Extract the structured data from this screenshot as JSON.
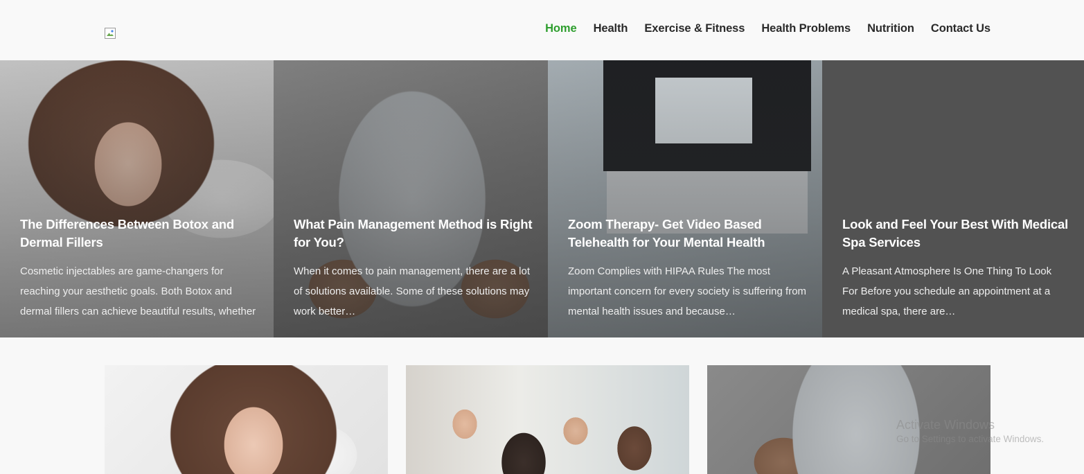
{
  "header": {
    "nav": [
      {
        "label": "Home",
        "active": true
      },
      {
        "label": "Health",
        "active": false
      },
      {
        "label": "Exercise & Fitness",
        "active": false
      },
      {
        "label": "Health Problems",
        "active": false
      },
      {
        "label": "Nutrition",
        "active": false
      },
      {
        "label": "Contact Us",
        "active": false
      }
    ]
  },
  "hero": [
    {
      "title": "The Differences Between Botox and Dermal Fillers",
      "excerpt": "Cosmetic injectables are game-changers for reaching your aesthetic goals. Both Botox and dermal fillers can achieve beautiful results, whether"
    },
    {
      "title": "What Pain Management Method is Right for You?",
      "excerpt": "When it comes to pain management, there are a lot of solutions available. Some of these solutions may work better…"
    },
    {
      "title": "Zoom Therapy- Get Video Based Telehealth for Your Mental Health",
      "excerpt": "Zoom Complies with HIPAA Rules The most important concern for every society is suffering from mental health issues and because…"
    },
    {
      "title": "Look and Feel Your Best With Medical Spa Services",
      "excerpt": "A Pleasant Atmosphere Is One Thing To Look For Before you schedule an appointment at a medical spa, there are…"
    }
  ],
  "watermark": {
    "title": "Activate Windows",
    "subtitle": "Go to Settings to activate Windows."
  },
  "colors": {
    "accent": "#2e9e2e",
    "nav_text": "#2a2a2a",
    "dark_card": "#525252"
  }
}
